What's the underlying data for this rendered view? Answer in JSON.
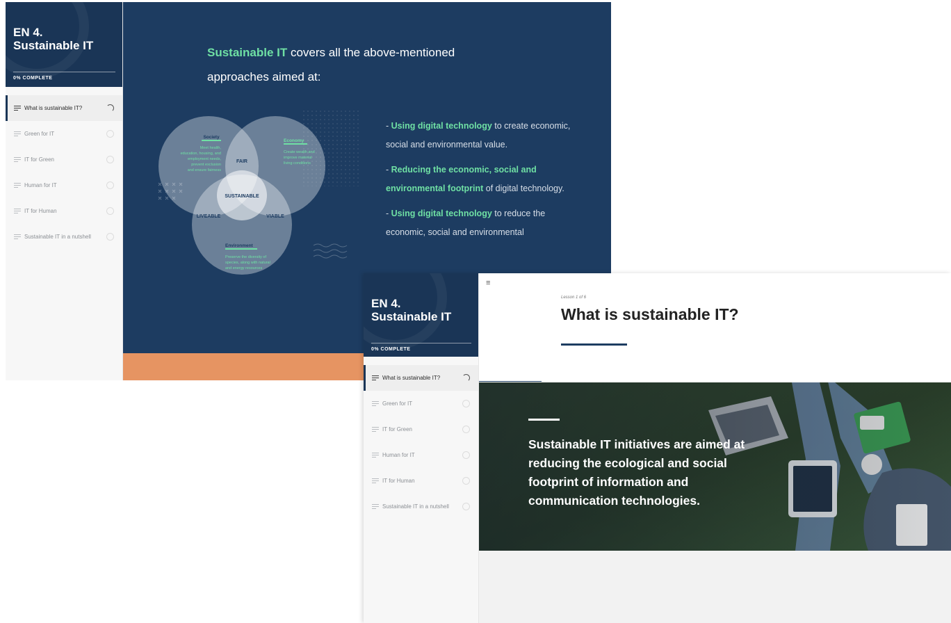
{
  "course": {
    "title_line1": "EN 4.",
    "title_line2": "Sustainable IT",
    "progress": "0% COMPLETE"
  },
  "lessons": [
    {
      "label": "What is sustainable IT?",
      "status": "in-progress"
    },
    {
      "label": "Green for IT",
      "status": "not-started"
    },
    {
      "label": "IT for Green",
      "status": "not-started"
    },
    {
      "label": "Human for IT",
      "status": "not-started"
    },
    {
      "label": "IT for Human",
      "status": "not-started"
    },
    {
      "label": "Sustainable IT in a nutshell",
      "status": "not-started"
    }
  ],
  "slide": {
    "heading_highlight": "Sustainable IT",
    "heading_rest_1": " covers all the above-mentioned",
    "heading_rest_2": "approaches aimed at:",
    "venn": {
      "society_title": "Society",
      "society_text": [
        "Meet health,",
        "education, housing, and",
        "employment needs,",
        "prevent exclusion",
        "and ensure fairness"
      ],
      "economy_title": "Economy",
      "economy_text": [
        "Create wealth and",
        "improve material",
        "living conditions"
      ],
      "environment_title": "Environment",
      "environment_text": [
        "Preserve the diversity of",
        "species, along with natural",
        "and energy resources"
      ],
      "fair": "FAIR",
      "sustainable": "SUSTAINABLE",
      "liveable": "LIVEABLE",
      "viable": "VIABLE"
    },
    "bullets": [
      {
        "prefix": "- ",
        "highlight": "Using digital technology",
        "rest": " to create economic, social and environmental value."
      },
      {
        "prefix": "- ",
        "highlight": "Reducing the economic, social and environmental footprint",
        "rest": " of digital technology."
      },
      {
        "prefix": "- ",
        "highlight": "Using digital technology",
        "rest": " to reduce the economic, social and environmental"
      }
    ]
  },
  "lesson_page": {
    "menu_icon": "≡",
    "lesson_counter": "Lesson 1 of 6",
    "title": "What is sustainable IT?",
    "hero_text": "Sustainable IT initiatives are aimed at reducing the ecological and social footprint of information and communication technologies."
  },
  "colors": {
    "navy": "#1d3c61",
    "accent_green": "#6fe0a4",
    "orange": "#e69462"
  }
}
